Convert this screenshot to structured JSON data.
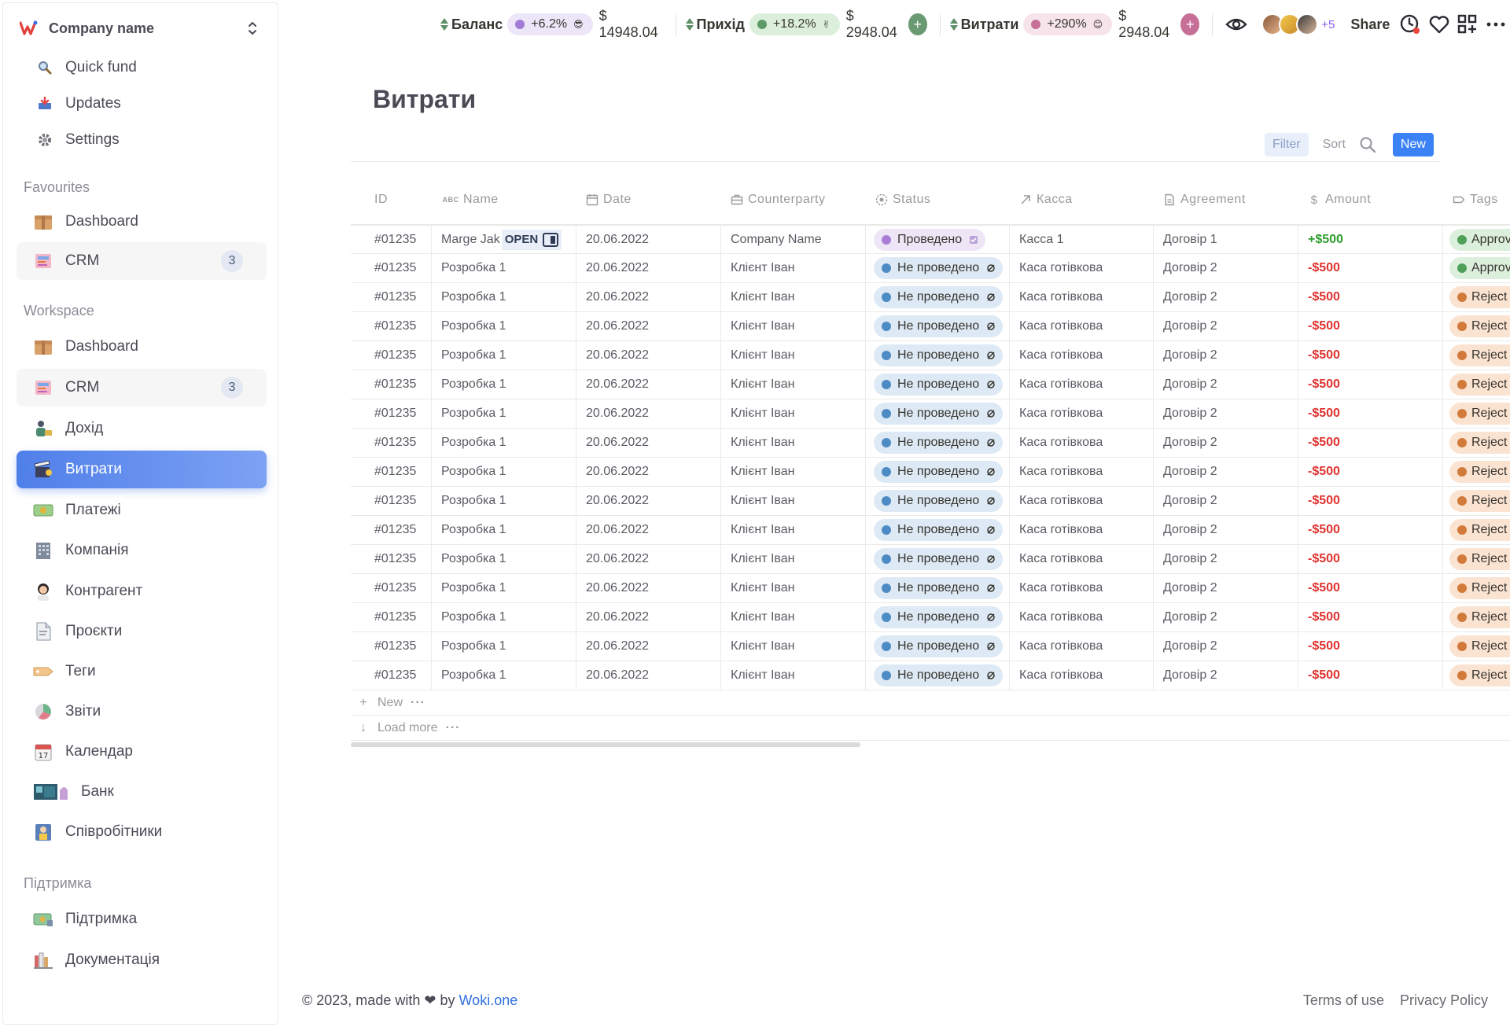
{
  "sidebar": {
    "workspace_name": "Company name",
    "top_items": [
      {
        "label": "Quick fund",
        "icon": "search-icon"
      },
      {
        "label": "Updates",
        "icon": "inbox-icon"
      },
      {
        "label": "Settings",
        "icon": "gear-icon"
      }
    ],
    "favourites_title": "Favourites",
    "favourites": [
      {
        "label": "Dashboard",
        "icon": "box-icon"
      },
      {
        "label": "CRM",
        "icon": "card-index-icon",
        "badge": "3"
      }
    ],
    "workspace_title": "Workspace",
    "workspace": [
      {
        "label": "Dashboard",
        "icon": "box-icon"
      },
      {
        "label": "CRM",
        "icon": "card-index-icon",
        "badge": "3"
      },
      {
        "label": "Дохід",
        "icon": "person-money-icon"
      },
      {
        "label": "Витрати",
        "icon": "clapper-icon",
        "active": true
      },
      {
        "label": "Платежі",
        "icon": "banknote-icon"
      },
      {
        "label": "Компанія",
        "icon": "office-building-icon"
      },
      {
        "label": "Контрагент",
        "icon": "woman-icon"
      },
      {
        "label": "Проєкти",
        "icon": "document-icon"
      },
      {
        "label": "Теги",
        "icon": "tag-icon"
      },
      {
        "label": "Звіти",
        "icon": "pie-chart-icon"
      },
      {
        "label": "Календар",
        "icon": "calendar-icon"
      },
      {
        "label": "Банк",
        "icon": "bank-icon"
      },
      {
        "label": "Співробітники",
        "icon": "employee-icon"
      }
    ],
    "support_title": "Підтримка",
    "support": [
      {
        "label": "Підтримка",
        "icon": "support-money-icon"
      },
      {
        "label": "Документація",
        "icon": "books-icon"
      }
    ]
  },
  "topbar": {
    "metrics": [
      {
        "label": "Баланс",
        "change": "+6.2%",
        "emoji": "😎",
        "amount": "$ 14948.04",
        "pill_bg": "#ece6f8",
        "dot": "#a27ad8"
      },
      {
        "label": "Прихід",
        "change": "+18.2%",
        "emoji": "✌",
        "amount": "$ 2948.04",
        "pill_bg": "#dcefdc",
        "dot": "#5e9a67",
        "plus_bg": "#6a9a73"
      },
      {
        "label": "Витрати",
        "change": "+290%",
        "emoji": "😊",
        "amount": "$ 2948.04",
        "pill_bg": "#f7e3ea",
        "dot": "#c66f97",
        "plus_bg": "#c66f97"
      }
    ],
    "avatars_more": "+5",
    "share_label": "Share"
  },
  "page": {
    "title": "Витрати",
    "filter_label": "Filter",
    "sort_label": "Sort",
    "new_label": "New"
  },
  "table": {
    "columns": [
      {
        "label": "ID",
        "icon": ""
      },
      {
        "label": "Name",
        "icon": "text-type-icon"
      },
      {
        "label": "Date",
        "icon": "calendar-icon"
      },
      {
        "label": "Counterparty",
        "icon": "briefcase-icon"
      },
      {
        "label": "Status",
        "icon": "status-icon"
      },
      {
        "label": "Касса",
        "icon": "arrow-icon"
      },
      {
        "label": "Agreement",
        "icon": "document-icon"
      },
      {
        "label": "Amount",
        "icon": "dollar-icon"
      },
      {
        "label": "Tags",
        "icon": "tag-icon"
      }
    ],
    "rows": [
      {
        "id": "#01235",
        "name": "Marge Jak",
        "open_label": "OPEN",
        "date": "20.06.2022",
        "counterparty": "Company Name",
        "status": "Проведено",
        "status_type": "done",
        "kasa": "Касса 1",
        "agreement": "Договір 1",
        "amount": "+$500",
        "tag": "Approve",
        "tag_type": "approve"
      },
      {
        "id": "#01235",
        "name": "Розробка 1",
        "date": "20.06.2022",
        "counterparty": "Клієнт Іван",
        "status": "Не проведено",
        "status_type": "not",
        "kasa": "Каса готівкова",
        "agreement": "Договір 2",
        "amount": "-$500",
        "tag": "Approve",
        "tag_type": "approve"
      },
      {
        "id": "#01235",
        "name": "Розробка 1",
        "date": "20.06.2022",
        "counterparty": "Клієнт Іван",
        "status": "Не проведено",
        "status_type": "not",
        "kasa": "Каса готівкова",
        "agreement": "Договір 2",
        "amount": "-$500",
        "tag": "Reject",
        "tag_type": "reject"
      },
      {
        "id": "#01235",
        "name": "Розробка 1",
        "date": "20.06.2022",
        "counterparty": "Клієнт Іван",
        "status": "Не проведено",
        "status_type": "not",
        "kasa": "Каса готівкова",
        "agreement": "Договір 2",
        "amount": "-$500",
        "tag": "Reject",
        "tag_type": "reject"
      },
      {
        "id": "#01235",
        "name": "Розробка 1",
        "date": "20.06.2022",
        "counterparty": "Клієнт Іван",
        "status": "Не проведено",
        "status_type": "not",
        "kasa": "Каса готівкова",
        "agreement": "Договір 2",
        "amount": "-$500",
        "tag": "Reject",
        "tag_type": "reject"
      },
      {
        "id": "#01235",
        "name": "Розробка 1",
        "date": "20.06.2022",
        "counterparty": "Клієнт Іван",
        "status": "Не проведено",
        "status_type": "not",
        "kasa": "Каса готівкова",
        "agreement": "Договір 2",
        "amount": "-$500",
        "tag": "Reject",
        "tag_type": "reject"
      },
      {
        "id": "#01235",
        "name": "Розробка 1",
        "date": "20.06.2022",
        "counterparty": "Клієнт Іван",
        "status": "Не проведено",
        "status_type": "not",
        "kasa": "Каса готівкова",
        "agreement": "Договір 2",
        "amount": "-$500",
        "tag": "Reject",
        "tag_type": "reject"
      },
      {
        "id": "#01235",
        "name": "Розробка 1",
        "date": "20.06.2022",
        "counterparty": "Клієнт Іван",
        "status": "Не проведено",
        "status_type": "not",
        "kasa": "Каса готівкова",
        "agreement": "Договір 2",
        "amount": "-$500",
        "tag": "Reject",
        "tag_type": "reject"
      },
      {
        "id": "#01235",
        "name": "Розробка 1",
        "date": "20.06.2022",
        "counterparty": "Клієнт Іван",
        "status": "Не проведено",
        "status_type": "not",
        "kasa": "Каса готівкова",
        "agreement": "Договір 2",
        "amount": "-$500",
        "tag": "Reject",
        "tag_type": "reject"
      },
      {
        "id": "#01235",
        "name": "Розробка 1",
        "date": "20.06.2022",
        "counterparty": "Клієнт Іван",
        "status": "Не проведено",
        "status_type": "not",
        "kasa": "Каса готівкова",
        "agreement": "Договір 2",
        "amount": "-$500",
        "tag": "Reject",
        "tag_type": "reject"
      },
      {
        "id": "#01235",
        "name": "Розробка 1",
        "date": "20.06.2022",
        "counterparty": "Клієнт Іван",
        "status": "Не проведено",
        "status_type": "not",
        "kasa": "Каса готівкова",
        "agreement": "Договір 2",
        "amount": "-$500",
        "tag": "Reject",
        "tag_type": "reject"
      },
      {
        "id": "#01235",
        "name": "Розробка 1",
        "date": "20.06.2022",
        "counterparty": "Клієнт Іван",
        "status": "Не проведено",
        "status_type": "not",
        "kasa": "Каса готівкова",
        "agreement": "Договір 2",
        "amount": "-$500",
        "tag": "Reject",
        "tag_type": "reject"
      },
      {
        "id": "#01235",
        "name": "Розробка 1",
        "date": "20.06.2022",
        "counterparty": "Клієнт Іван",
        "status": "Не проведено",
        "status_type": "not",
        "kasa": "Каса готівкова",
        "agreement": "Договір 2",
        "amount": "-$500",
        "tag": "Reject",
        "tag_type": "reject"
      },
      {
        "id": "#01235",
        "name": "Розробка 1",
        "date": "20.06.2022",
        "counterparty": "Клієнт Іван",
        "status": "Не проведено",
        "status_type": "not",
        "kasa": "Каса готівкова",
        "agreement": "Договір 2",
        "amount": "-$500",
        "tag": "Reject",
        "tag_type": "reject"
      },
      {
        "id": "#01235",
        "name": "Розробка 1",
        "date": "20.06.2022",
        "counterparty": "Клієнт Іван",
        "status": "Не проведено",
        "status_type": "not",
        "kasa": "Каса готівкова",
        "agreement": "Договір 2",
        "amount": "-$500",
        "tag": "Reject",
        "tag_type": "reject"
      },
      {
        "id": "#01235",
        "name": "Розробка 1",
        "date": "20.06.2022",
        "counterparty": "Клієнт Іван",
        "status": "Не проведено",
        "status_type": "not",
        "kasa": "Каса готівкова",
        "agreement": "Договір 2",
        "amount": "-$500",
        "tag": "Reject",
        "tag_type": "reject"
      }
    ],
    "new_row_label": "New",
    "load_more_label": "Load more"
  },
  "footer": {
    "copyright_prefix": "© 2023, made with",
    "by_label": "by",
    "brand_link": "Woki.one",
    "terms_label": "Terms of use",
    "privacy_label": "Privacy Policy"
  }
}
